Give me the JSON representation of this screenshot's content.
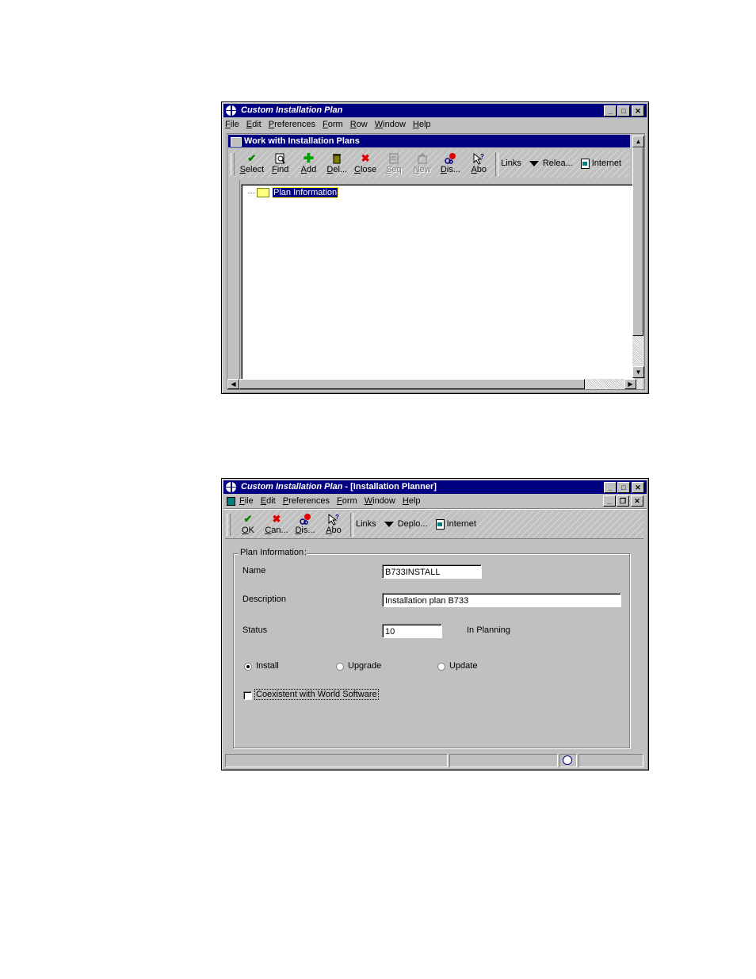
{
  "window1": {
    "title": "Custom Installation Plan",
    "menu": [
      "File",
      "Edit",
      "Preferences",
      "Form",
      "Row",
      "Window",
      "Help"
    ],
    "child_title": "Work with Installation Plans",
    "toolbar": {
      "buttons": [
        {
          "label": "Select",
          "icon": "check-icon",
          "enabled": true
        },
        {
          "label": "Find",
          "icon": "find-icon",
          "enabled": true
        },
        {
          "label": "Add",
          "icon": "plus-icon",
          "enabled": true
        },
        {
          "label": "Del...",
          "icon": "trash-icon",
          "enabled": true
        },
        {
          "label": "Close",
          "icon": "x-icon",
          "enabled": true
        },
        {
          "label": "Seq",
          "icon": "sequence-icon",
          "enabled": false
        },
        {
          "label": "New",
          "icon": "new-icon",
          "enabled": false
        },
        {
          "label": "Dis...",
          "icon": "display-icon",
          "enabled": true
        },
        {
          "label": "Abo",
          "icon": "about-icon",
          "enabled": true
        }
      ],
      "links_label": "Links",
      "release_label": "Relea...",
      "internet_label": "Internet"
    },
    "tree": {
      "node_label": "Plan Information"
    }
  },
  "window2": {
    "title": "Custom Installation Plan",
    "title_suffix": " - [Installation Planner]",
    "menu": [
      "File",
      "Edit",
      "Preferences",
      "Form",
      "Window",
      "Help"
    ],
    "toolbar": {
      "buttons": [
        {
          "label": "OK",
          "icon": "check-icon"
        },
        {
          "label": "Can...",
          "icon": "x-icon"
        },
        {
          "label": "Dis...",
          "icon": "display-icon"
        },
        {
          "label": "Abo",
          "icon": "about-icon"
        }
      ],
      "links_label": "Links",
      "deploy_label": "Deplo...",
      "internet_label": "Internet"
    },
    "form": {
      "group_label": "Plan Information",
      "name_label": "Name",
      "name_value": "B733INSTALL",
      "description_label": "Description",
      "description_value": "Installation plan B733",
      "status_label": "Status",
      "status_value": "10",
      "status_text": "In Planning",
      "radio_install": "Install",
      "radio_upgrade": "Upgrade",
      "radio_update": "Update",
      "selected_radio": "Install",
      "checkbox_label": "Coexistent with World Software",
      "checkbox_checked": false
    }
  }
}
